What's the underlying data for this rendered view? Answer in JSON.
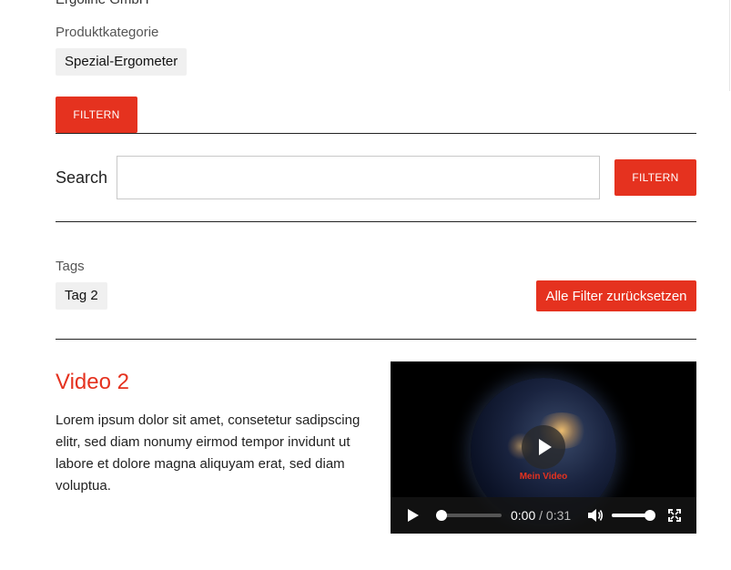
{
  "top": {
    "cut_text": "Ergoline GmbH"
  },
  "filters": {
    "category_label": "Produktkategorie",
    "category_chip": "Spezial-Ergometer",
    "filter_button": "FILTERN"
  },
  "search": {
    "label": "Search",
    "value": "",
    "placeholder": "",
    "button": "FILTERN"
  },
  "tags": {
    "label": "Tags",
    "chip": "Tag 2",
    "reset_button": "Alle Filter zurücksetzen"
  },
  "video": {
    "title": "Video 2",
    "description": "Lorem ipsum dolor sit amet, consetetur sadipscing elitr, sed diam nonumy eirmod tempor invidunt ut labore et dolore magna aliquyam erat, sed diam voluptua.",
    "watermark": "Mein Video",
    "current_time": "0:00",
    "separator": "/",
    "duration": "0:31",
    "progress_fraction": 0.08,
    "volume_fraction": 0.95
  },
  "colors": {
    "accent": "#e5321f",
    "chip_bg": "#f0f0f0"
  }
}
